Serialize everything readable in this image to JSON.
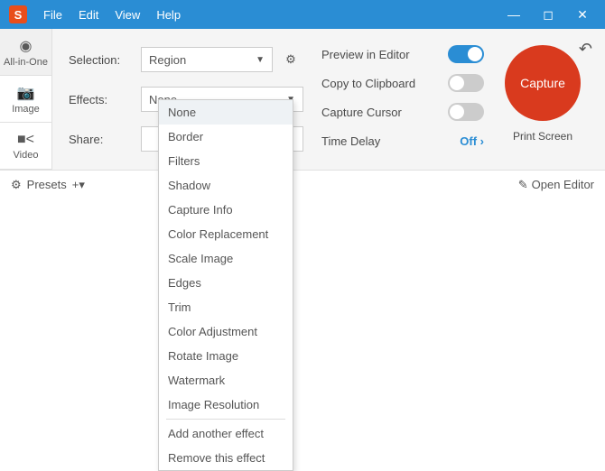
{
  "title": {
    "logo": "S"
  },
  "menu": {
    "file": "File",
    "edit": "Edit",
    "view": "View",
    "help": "Help"
  },
  "sidebar": {
    "allinone": "All-in-One",
    "image": "Image",
    "video": "Video"
  },
  "labels": {
    "selection": "Selection:",
    "effects": "Effects:",
    "share": "Share:"
  },
  "values": {
    "selection": "Region",
    "effects": "None"
  },
  "options": {
    "preview": "Preview in Editor",
    "clipboard": "Copy to Clipboard",
    "cursor": "Capture Cursor",
    "timedelay": "Time Delay",
    "off": "Off ›"
  },
  "capture": {
    "button": "Capture",
    "hint": "Print Screen"
  },
  "bottom": {
    "presets": "Presets",
    "openeditor": "Open Editor"
  },
  "dropdown": {
    "items": [
      "None",
      "Border",
      "Filters",
      "Shadow",
      "Capture Info",
      "Color Replacement",
      "Scale Image",
      "Edges",
      "Trim",
      "Color Adjustment",
      "Rotate Image",
      "Watermark",
      "Image Resolution"
    ],
    "footer": [
      "Add another effect",
      "Remove this effect"
    ]
  },
  "winctrl": {
    "min": "—",
    "max": "◻",
    "close": "✕"
  }
}
